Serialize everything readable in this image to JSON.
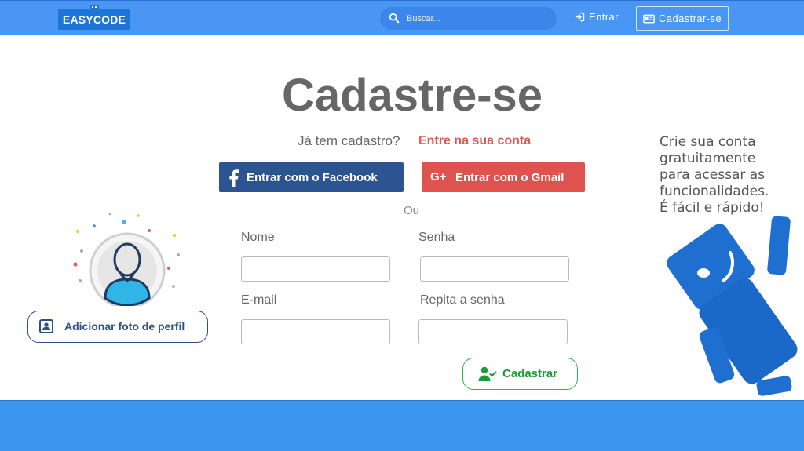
{
  "header": {
    "logo_text": "EASYCODE",
    "search_placeholder": "Buscar...",
    "login_label": "Entrar",
    "signup_label": "Cadastrar-se"
  },
  "main": {
    "title": "Cadastre-se",
    "have_account_text": "Já tem cadastro?",
    "login_link": "Entre na sua conta",
    "facebook_button": "Entrar com o Facebook",
    "gmail_button": "Entrar com o Gmail",
    "or_text": "Ou",
    "form": {
      "name_label": "Nome",
      "name_value": "",
      "password_label": "Senha",
      "password_value": "",
      "email_label": "E-mail",
      "email_value": "",
      "repeat_password_label": "Repita a senha",
      "repeat_password_value": "",
      "submit_label": "Cadastrar"
    },
    "add_photo_button": "Adicionar foto de perfil"
  },
  "promo": {
    "lines": [
      "Crie sua conta",
      "gratuitamente",
      "para acessar as",
      "funcionalidades.",
      "É fácil e rápido!"
    ]
  },
  "colors": {
    "header_bg": "#4a96f5",
    "facebook": "#2b5490",
    "gmail": "#de534e",
    "register": "#2fb34d",
    "link": "#e05a55",
    "footer_bg": "#3c95ee"
  },
  "icons": {
    "search": "search-icon",
    "login": "sign-in-icon",
    "signup": "id-card-icon",
    "facebook": "facebook-icon",
    "gmail": "google-plus-icon",
    "register": "user-check-icon",
    "photo": "portrait-icon"
  }
}
